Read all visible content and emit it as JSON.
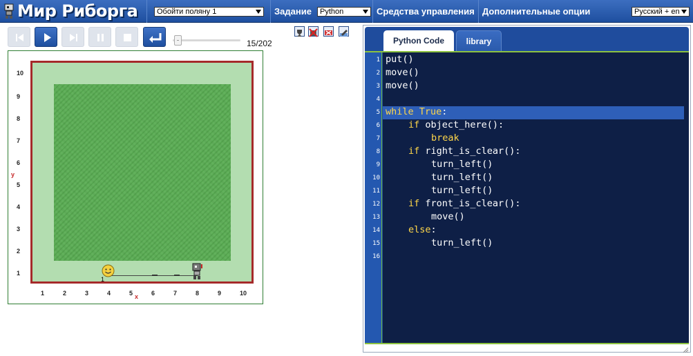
{
  "header": {
    "app_title": "Мир Риборга",
    "world_select": "Обойти поляну 1",
    "task_label": "Задание",
    "language_select": "Python",
    "controls_menu": "Средства управления",
    "options_menu": "Дополнительные опции",
    "ui_language_select": "Русский + en"
  },
  "controls": {
    "step_counter": "15/202"
  },
  "world": {
    "y_labels": [
      "10",
      "9",
      "8",
      "7",
      "6",
      "5",
      "4",
      "3",
      "2",
      "1"
    ],
    "x_labels": [
      "1",
      "2",
      "3",
      "4",
      "5",
      "6",
      "7",
      "8",
      "9",
      "10"
    ],
    "y_axis_letter": "y",
    "x_axis_letter": "x",
    "object_count": "1"
  },
  "editor": {
    "tabs": [
      "Python Code",
      "library"
    ],
    "line_numbers": [
      "1",
      "2",
      "3",
      "4",
      "5",
      "6",
      "7",
      "8",
      "9",
      "10",
      "11",
      "12",
      "13",
      "14",
      "15",
      "16"
    ],
    "code": {
      "l1": "put()",
      "l2": "move()",
      "l3": "move()",
      "l5_kw": "while True",
      "l5_rest": ":",
      "l6_kw": "if",
      "l6_rest": " object_here():",
      "l7_kw": "break",
      "l8_kw": "if",
      "l8_rest": " right_is_clear():",
      "l9": "turn_left()",
      "l10": "turn_left()",
      "l11": "turn_left()",
      "l12_kw": "if",
      "l12_rest": " front_is_clear():",
      "l13": "move()",
      "l14_kw": "else",
      "l14_rest": ":",
      "l15": "turn_left()"
    }
  },
  "colors": {
    "header_blue": "#2a5aab",
    "editor_bg": "#0e1f46",
    "keyword": "#ffd74a",
    "wall": "#a52a2a",
    "grass": "#55a64f"
  }
}
